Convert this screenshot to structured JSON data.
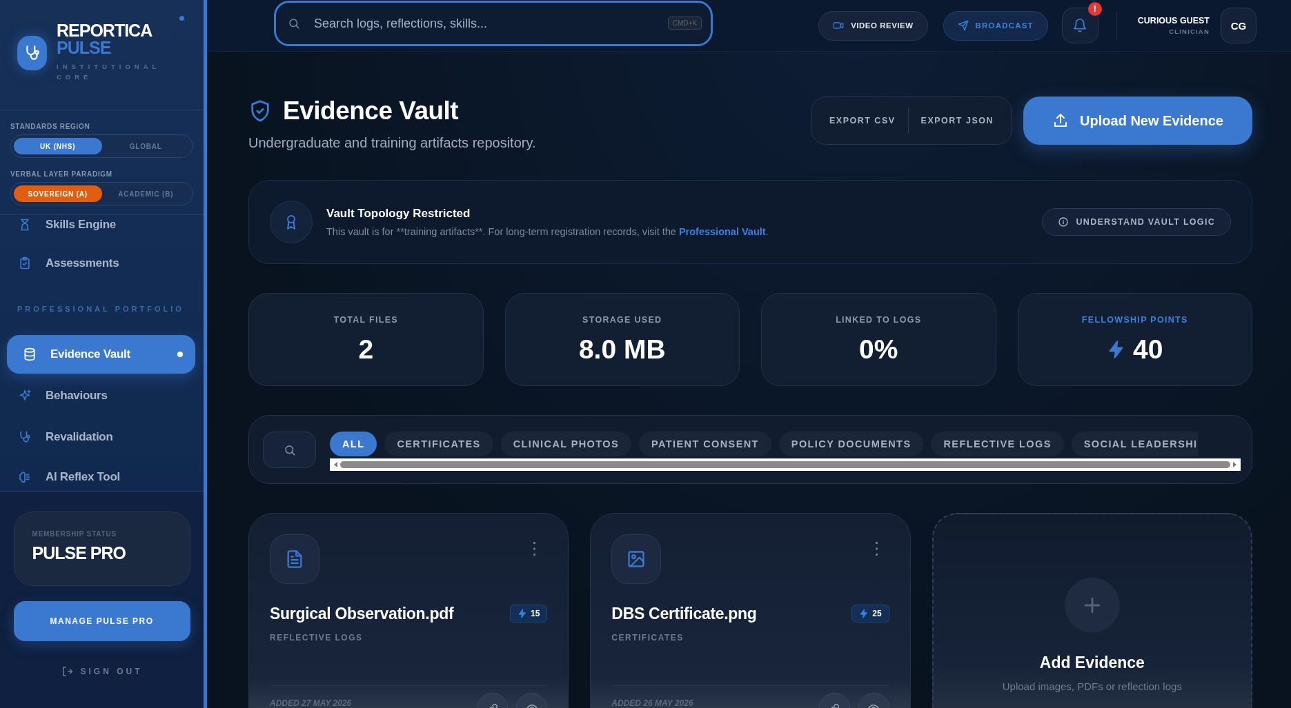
{
  "sidebar": {
    "brand": {
      "name": "REPORTICA",
      "accent": "PULSE",
      "tagline": "INSTITUTIONAL CORE"
    },
    "toggles": [
      {
        "label": "STANDARDS REGION",
        "color": "#3b78d0",
        "options": [
          {
            "label": "UK (NHS)",
            "selected": true
          },
          {
            "label": "GLOBAL",
            "selected": false
          }
        ]
      },
      {
        "label": "VERBAL LAYER PARADIGM",
        "color": "#e35d0e",
        "options": [
          {
            "label": "SOVEREIGN (A)",
            "selected": true
          },
          {
            "label": "ACADEMIC (B)",
            "selected": false
          }
        ]
      }
    ],
    "nav": [
      {
        "kind": "item",
        "label": "Skills Engine",
        "selected": false
      },
      {
        "kind": "item",
        "label": "Assessments",
        "selected": false
      },
      {
        "kind": "section",
        "label": "PROFESSIONAL PORTFOLIO"
      },
      {
        "kind": "item",
        "label": "Evidence Vault",
        "selected": true
      },
      {
        "kind": "item",
        "label": "Behaviours",
        "selected": false
      },
      {
        "kind": "item",
        "label": "Revalidation",
        "selected": false
      },
      {
        "kind": "item",
        "label": "AI Reflex Tool",
        "selected": false
      }
    ],
    "membership": {
      "label": "MEMBERSHIP STATUS",
      "plan": "PULSE PRO"
    },
    "manage_button": "MANAGE PULSE PRO",
    "sign_out": "SIGN OUT"
  },
  "header": {
    "search": {
      "placeholder": "Search logs, reflections, skills...",
      "shortcut": "CMD+K"
    },
    "buttons": [
      {
        "kind": "video",
        "label": "VIDEO REVIEW"
      },
      {
        "kind": "broadcast",
        "label": "BROADCAST"
      }
    ],
    "notifications": {
      "badge": "!"
    },
    "user": {
      "name": "CURIOUS GUEST",
      "role": "CLINICIAN",
      "initials": "CG"
    }
  },
  "page": {
    "title": "Evidence Vault",
    "subtitle": "Undergraduate and training artifacts repository.",
    "exports": [
      "EXPORT CSV",
      "EXPORT JSON"
    ],
    "upload_button": "Upload New Evidence"
  },
  "notice": {
    "title": "Vault Topology Restricted",
    "text": "This vault is for **training artifacts**. For long-term registration records, visit the ",
    "link": "Professional Vault",
    "text_end": ".",
    "button": "UNDERSTAND VAULT LOGIC"
  },
  "stats": [
    {
      "kind": "plain",
      "label": "TOTAL FILES",
      "value": "2"
    },
    {
      "kind": "plain",
      "label": "STORAGE USED",
      "value": "8.0 MB"
    },
    {
      "kind": "plain",
      "label": "LINKED TO LOGS",
      "value": "0%"
    },
    {
      "kind": "points",
      "label": "FELLOWSHIP POINTS",
      "value": "40"
    }
  ],
  "filters": [
    {
      "label": "ALL",
      "selected": true
    },
    {
      "label": "CERTIFICATES",
      "selected": false
    },
    {
      "label": "CLINICAL PHOTOS",
      "selected": false
    },
    {
      "label": "PATIENT CONSENT",
      "selected": false
    },
    {
      "label": "POLICY DOCUMENTS",
      "selected": false
    },
    {
      "label": "REFLECTIVE LOGS",
      "selected": false
    },
    {
      "label": "SOCIAL LEADERSHI",
      "selected": false
    }
  ],
  "evidence": [
    {
      "kind": "document",
      "title": "Surgical Observation.pdf",
      "points": "15",
      "category": "REFLECTIVE LOGS",
      "added": "ADDED 27 MAY 2026"
    },
    {
      "kind": "image",
      "title": "DBS Certificate.png",
      "points": "25",
      "category": "CERTIFICATES",
      "added": "ADDED 26 MAY 2026"
    },
    {
      "kind": "add",
      "title": "Add Evidence",
      "subtitle": "Upload images, PDFs or reflection logs"
    }
  ]
}
